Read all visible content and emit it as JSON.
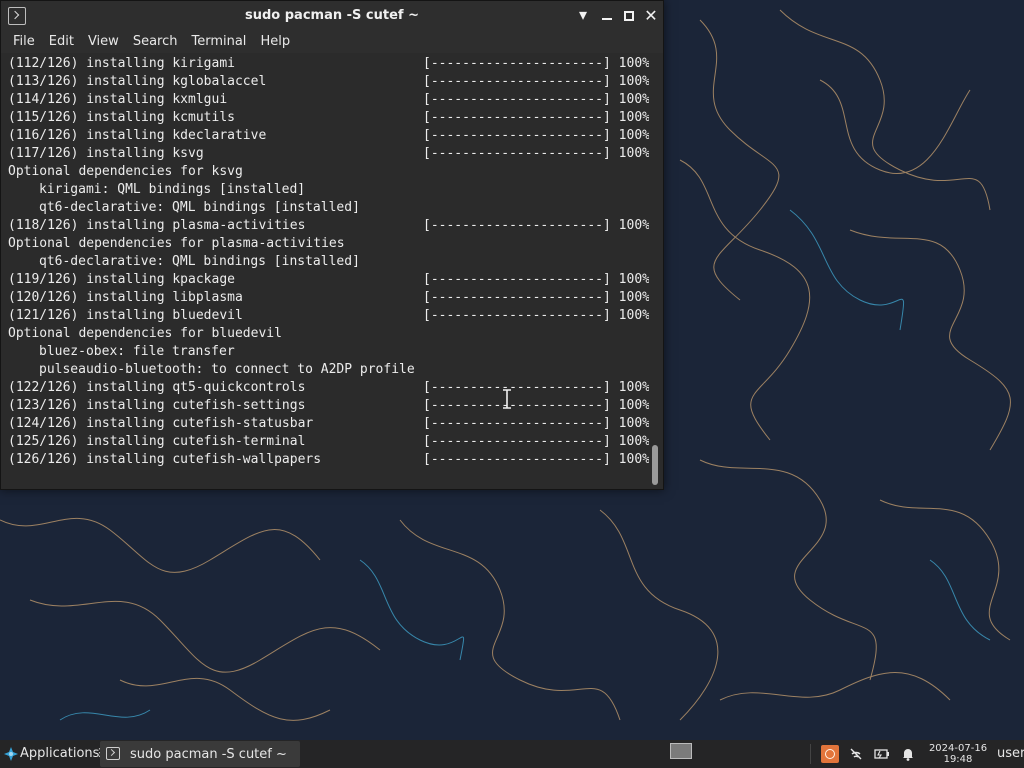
{
  "window": {
    "title": "sudo pacman -S cutef ~",
    "controls": {
      "minimize": "▾",
      "close": "✕"
    }
  },
  "menu": [
    "File",
    "Edit",
    "View",
    "Search",
    "Terminal",
    "Help"
  ],
  "terminal": {
    "progress_bar": "[----------------------] 100%",
    "lines": [
      {
        "text": "(112/126) installing kirigami",
        "progress": true
      },
      {
        "text": "(113/126) installing kglobalaccel",
        "progress": true
      },
      {
        "text": "(114/126) installing kxmlgui",
        "progress": true
      },
      {
        "text": "(115/126) installing kcmutils",
        "progress": true
      },
      {
        "text": "(116/126) installing kdeclarative",
        "progress": true
      },
      {
        "text": "(117/126) installing ksvg",
        "progress": true
      },
      {
        "text": "Optional dependencies for ksvg",
        "progress": false
      },
      {
        "text": "kirigami: QML bindings [installed]",
        "progress": false,
        "indent": true
      },
      {
        "text": "qt6-declarative: QML bindings [installed]",
        "progress": false,
        "indent": true
      },
      {
        "text": "(118/126) installing plasma-activities",
        "progress": true
      },
      {
        "text": "Optional dependencies for plasma-activities",
        "progress": false
      },
      {
        "text": "qt6-declarative: QML bindings [installed]",
        "progress": false,
        "indent": true
      },
      {
        "text": "(119/126) installing kpackage",
        "progress": true
      },
      {
        "text": "(120/126) installing libplasma",
        "progress": true
      },
      {
        "text": "(121/126) installing bluedevil",
        "progress": true
      },
      {
        "text": "Optional dependencies for bluedevil",
        "progress": false
      },
      {
        "text": "bluez-obex: file transfer",
        "progress": false,
        "indent": true
      },
      {
        "text": "pulseaudio-bluetooth: to connect to A2DP profile",
        "progress": false,
        "indent": true
      },
      {
        "text": "(122/126) installing qt5-quickcontrols",
        "progress": true
      },
      {
        "text": "(123/126) installing cutefish-settings",
        "progress": true
      },
      {
        "text": "(124/126) installing cutefish-statusbar",
        "progress": true
      },
      {
        "text": "(125/126) installing cutefish-terminal",
        "progress": true
      },
      {
        "text": "(126/126) installing cutefish-wallpapers",
        "progress": true
      }
    ]
  },
  "taskbar": {
    "apps_label": "Applications",
    "separator": "⋮",
    "task_label": "sudo pacman -S cutef ~",
    "clock_date": "2024-07-16",
    "clock_time": "19:48",
    "user_label": "user"
  },
  "colors": {
    "wallpaper": "#1b2538",
    "contour_warm": "#c8a070",
    "contour_cool": "#3fa0c8",
    "tray_update": "#e2753b"
  }
}
